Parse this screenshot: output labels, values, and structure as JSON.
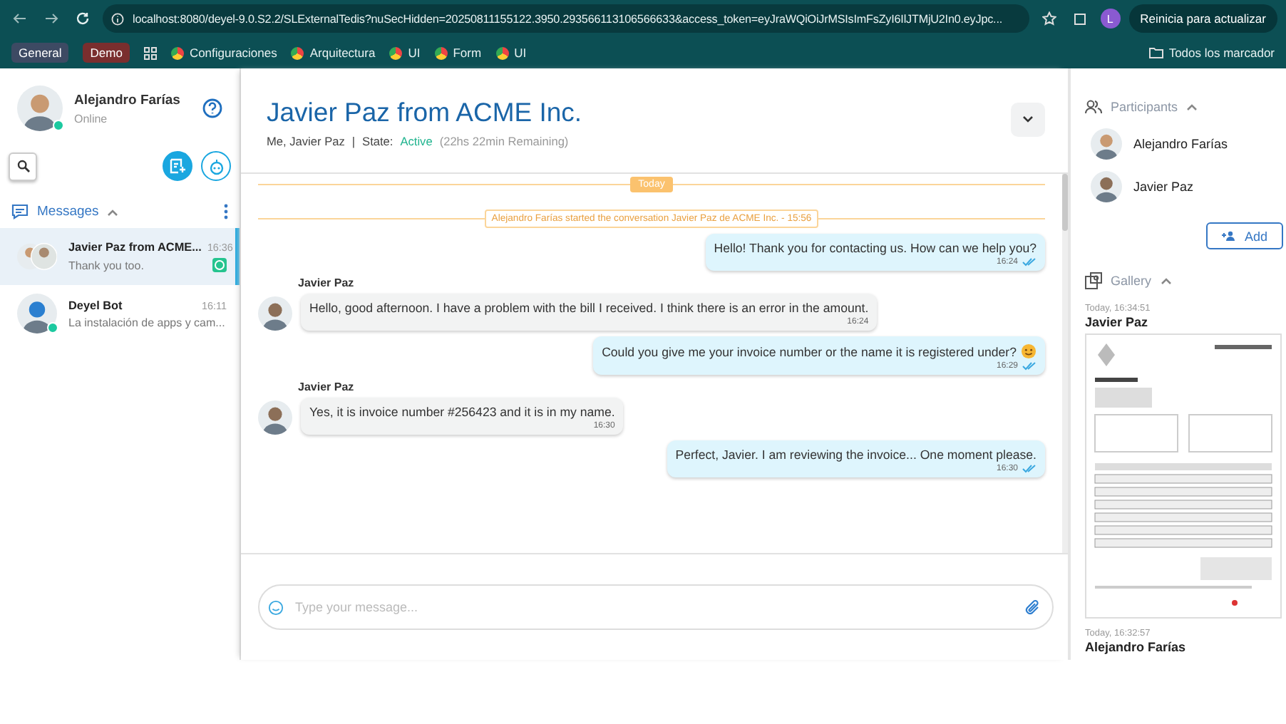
{
  "browser": {
    "url": "localhost:8080/deyel-9.0.S2.2/SLExternalTedis?nuSecHidden=20250811155122.3950.293566113106566633&access_token=eyJraWQiOiJrMSIsImFsZyI6IlJTMjU2In0.eyJpc...",
    "profile_initial": "L",
    "update_button": "Reinicia para actualizar",
    "bookmarks": [
      {
        "kind": "tag",
        "label": "General",
        "color": "#3d4a63"
      },
      {
        "kind": "tag",
        "label": "Demo",
        "color": "#7a2e2e"
      },
      {
        "kind": "apps"
      },
      {
        "kind": "link",
        "label": "Configuraciones"
      },
      {
        "kind": "link",
        "label": "Arquitectura"
      },
      {
        "kind": "link",
        "label": "UI"
      },
      {
        "kind": "link",
        "label": "Form"
      },
      {
        "kind": "link",
        "label": "UI"
      }
    ],
    "all_bookmarks": "Todos los marcador"
  },
  "user": {
    "name": "Alejandro Farías",
    "status": "Online",
    "online": true
  },
  "messages_section": {
    "title": "Messages",
    "expanded": true
  },
  "conversations": [
    {
      "name": "Javier Paz from ACME...",
      "time": "16:36",
      "preview": "Thank you too.",
      "selected": true,
      "group": true,
      "online": false,
      "whatsapp": true
    },
    {
      "name": "Deyel Bot",
      "time": "16:11",
      "preview": "La instalación de apps y cam...",
      "selected": false,
      "group": false,
      "online": true,
      "whatsapp": false
    }
  ],
  "chat": {
    "title": "Javier Paz from ACME Inc.",
    "members": "Me, Javier Paz",
    "separator": "|",
    "state_label": "State:",
    "state": "Active",
    "remaining": "(22hs 22min Remaining)",
    "day": "Today",
    "system_note": "Alejandro Farías started the conversation Javier Paz de ACME Inc. - 15:56",
    "messages": [
      {
        "kind": "outgoing",
        "text": "Hello! Thank you for contacting us. How can we help you?",
        "time": "16:24",
        "read": true,
        "emoji": false
      },
      {
        "kind": "incoming",
        "sender": "Javier Paz",
        "text": "Hello, good afternoon. I have a problem with the bill I received. I think there is an error in the amount.",
        "time": "16:24"
      },
      {
        "kind": "outgoing",
        "text": "Could you give me your invoice number or the name it is registered under?",
        "time": "16:29",
        "read": true,
        "emoji": true
      },
      {
        "kind": "incoming",
        "sender": "Javier Paz",
        "text": "Yes, it is invoice number #256423 and it is in my name.",
        "time": "16:30"
      },
      {
        "kind": "outgoing",
        "text": "Perfect, Javier. I am reviewing the invoice... One moment please.",
        "time": "16:30",
        "read": true,
        "emoji": false
      }
    ],
    "composer": {
      "placeholder": "Type your message..."
    }
  },
  "participants": {
    "title": "Participants",
    "expanded": true,
    "items": [
      {
        "name": "Alejandro Farías"
      },
      {
        "name": "Javier Paz"
      }
    ],
    "add_button": "Add"
  },
  "gallery": {
    "title": "Gallery",
    "expanded": true,
    "items": [
      {
        "date": "Today, 16:34:51",
        "author": "Javier Paz",
        "kind": "picture"
      },
      {
        "date": "Today, 16:32:57",
        "author": "Alejandro Farías"
      }
    ]
  }
}
